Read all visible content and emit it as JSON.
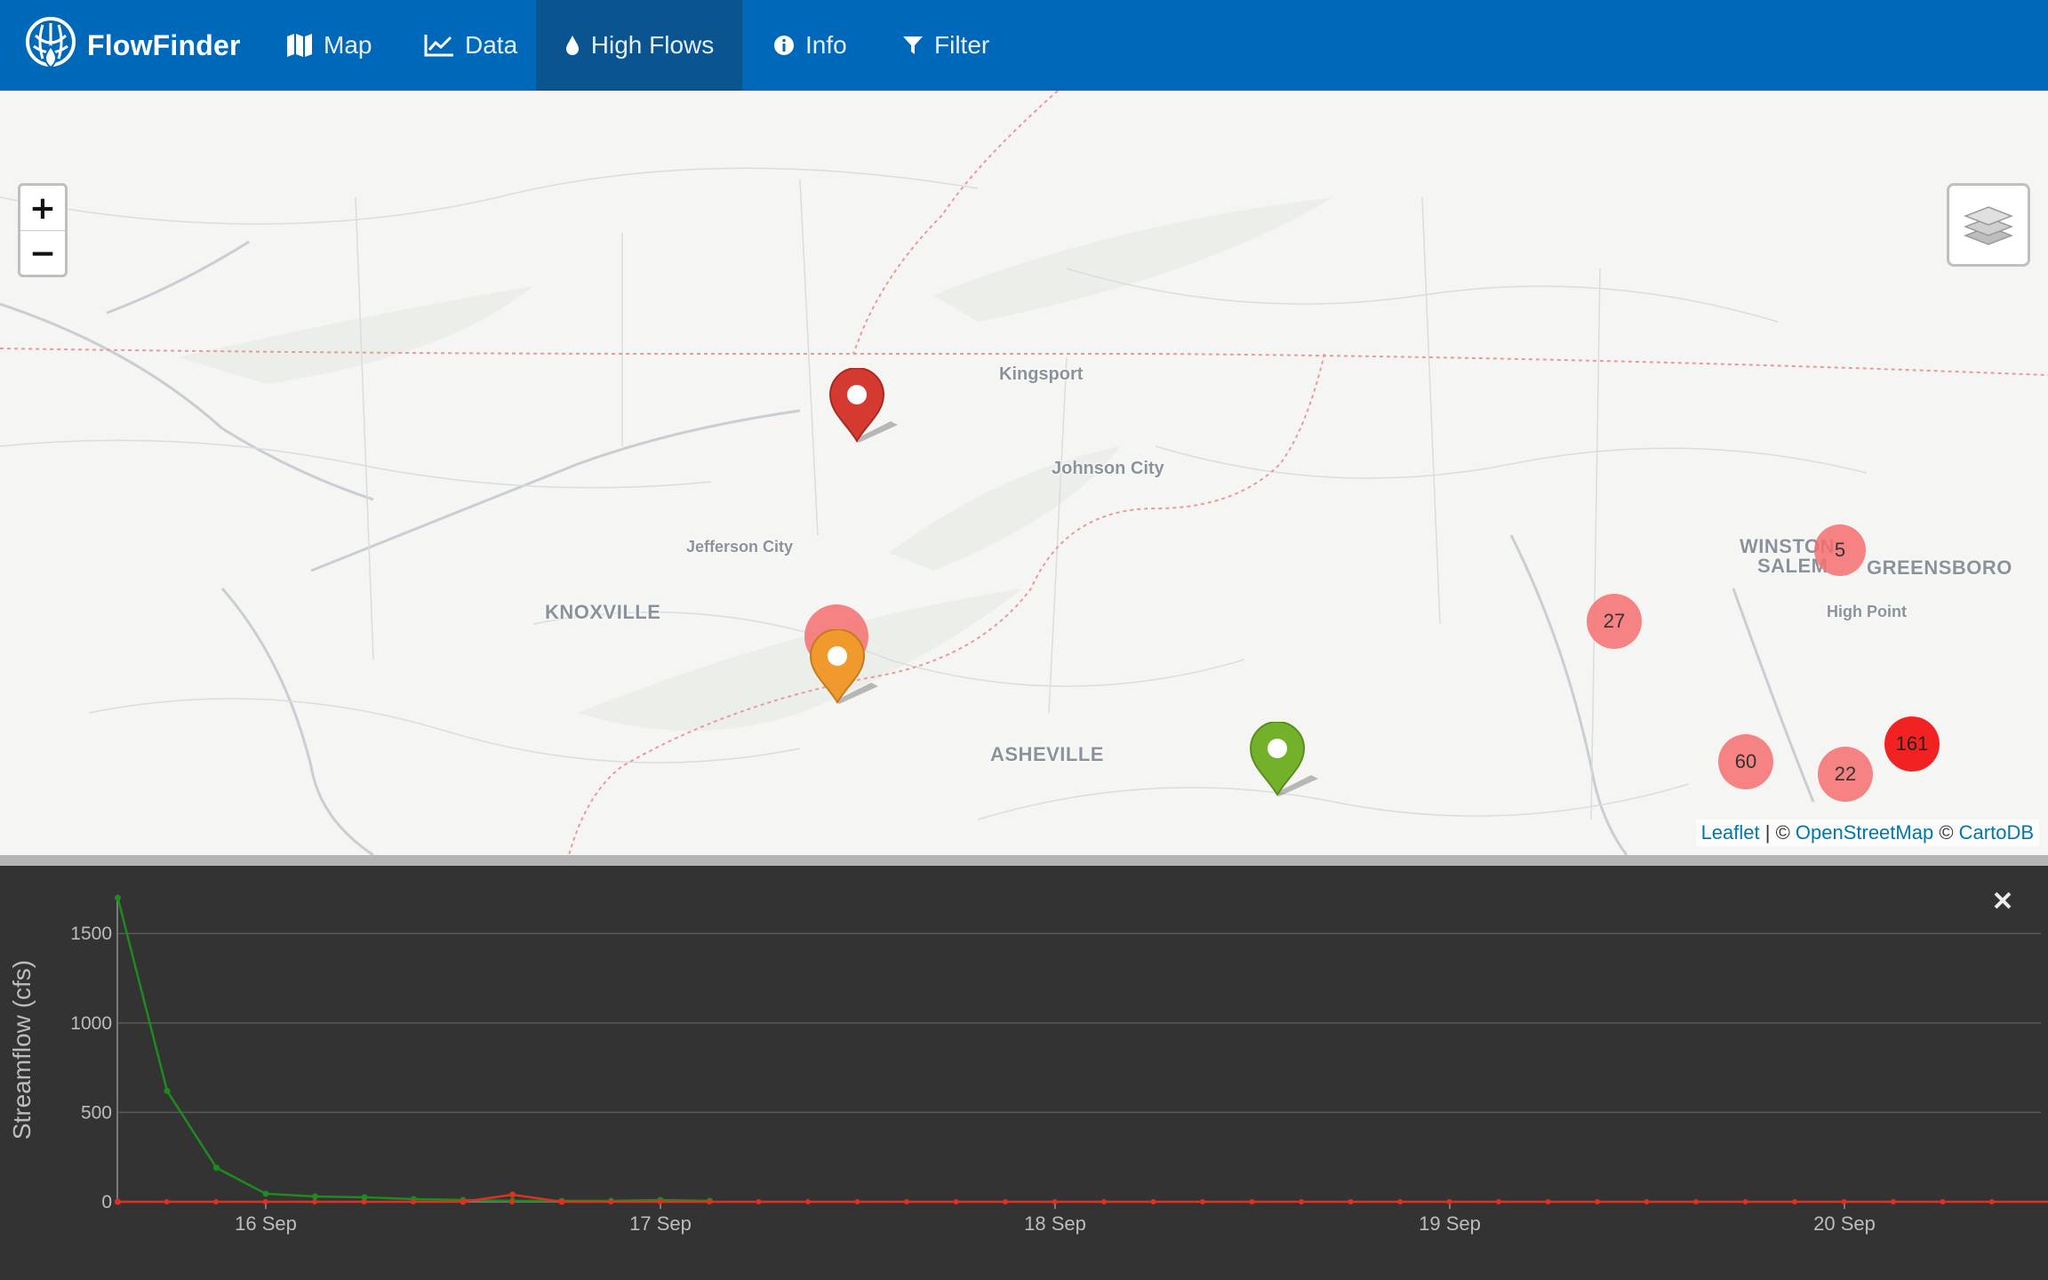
{
  "app": {
    "title": "FlowFinder"
  },
  "nav": {
    "items": [
      {
        "label": "Map",
        "icon": "map-icon"
      },
      {
        "label": "Data",
        "icon": "line-chart-icon"
      },
      {
        "label": "High Flows",
        "icon": "droplet-icon",
        "active": true
      },
      {
        "label": "Info",
        "icon": "info-circle-icon"
      },
      {
        "label": "Filter",
        "icon": "filter-icon"
      }
    ]
  },
  "map": {
    "zoom_in_label": "+",
    "zoom_out_label": "−",
    "layers_icon": "layers-icon",
    "places": [
      "Kingsport",
      "Johnson City",
      "Jefferson City",
      "KNOXVILLE",
      "ASHEVILLE",
      "WINSTON",
      "SALEM",
      "GREENSBORO",
      "High Point"
    ],
    "clusters": [
      "5",
      "27",
      "60",
      "22",
      "161"
    ],
    "markers": [
      {
        "name": "red-marker",
        "color": "#d43a2f"
      },
      {
        "name": "orange-marker",
        "color": "#f09a2e"
      },
      {
        "name": "green-marker",
        "color": "#73b12a"
      }
    ],
    "attribution": {
      "leaflet": "Leaflet",
      "sep": " | © ",
      "osm": "OpenStreetMap",
      "sep2": " © ",
      "carto": "CartoDB"
    }
  },
  "chart": {
    "close_icon": "close-icon"
  },
  "chart_data": {
    "type": "line",
    "ylabel": "Streamflow (cfs)",
    "xlabel": "",
    "ylim": [
      0,
      1700
    ],
    "yticks": [
      "0",
      "500",
      "1000",
      "1500"
    ],
    "xticks": [
      "16 Sep",
      "17 Sep",
      "18 Sep",
      "19 Sep",
      "20 Sep"
    ],
    "grid": true,
    "series": [
      {
        "color": "#1f8a1f",
        "x": [
          "15 Sep 15:00",
          "15 Sep 18:00",
          "15 Sep 21:00",
          "16 Sep 00:00",
          "16 Sep 03:00",
          "16 Sep 06:00",
          "16 Sep 09:00",
          "16 Sep 12:00",
          "16 Sep 15:00",
          "16 Sep 18:00",
          "16 Sep 21:00",
          "17 Sep 00:00",
          "17 Sep 03:00"
        ],
        "values": [
          1700,
          620,
          190,
          45,
          30,
          25,
          15,
          10,
          5,
          5,
          5,
          10,
          5
        ]
      },
      {
        "color": "#e03020",
        "x": [
          "15 Sep 15:00",
          "16 Sep 12:00",
          "16 Sep 15:00",
          "16 Sep 18:00",
          "20 Sep 15:00"
        ],
        "values": [
          0,
          0,
          40,
          0,
          0
        ]
      }
    ]
  }
}
